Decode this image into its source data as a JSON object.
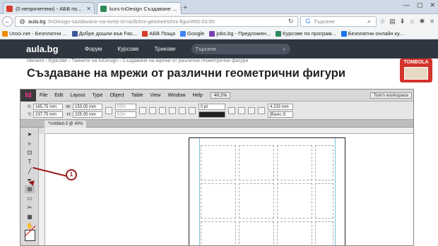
{
  "browser": {
    "tabs": [
      {
        "label": "(0 непрочетени) - АБВ по...",
        "favicon_color": "#d83b2c"
      },
      {
        "label": "kurs-InDesign Създаване ...",
        "favicon_color": "#2c8a5b"
      }
    ],
    "url_host": "aula.bg",
    "url_path": "/InDesign-sazdavane-na-mreji-ot-razlichni-geometrichni-figuri#00:03:50",
    "search_placeholder": "Търсене",
    "bookmarks": [
      {
        "label": "Uroci.net - Безплатни ...",
        "color": "#f08c00"
      },
      {
        "label": "Добре дошли във Fac...",
        "color": "#3b5998"
      },
      {
        "label": "АБВ Поща",
        "color": "#d83b2c"
      },
      {
        "label": "Google",
        "color": "#4285f4"
      },
      {
        "label": "jobs.bg - Предложен...",
        "color": "#7a3fb5"
      },
      {
        "label": "Курсове по програм...",
        "color": "#2c8a5b"
      },
      {
        "label": "Безплатни онлайн ку...",
        "color": "#1a73e8"
      }
    ]
  },
  "site": {
    "logo": "aula.bg",
    "nav": [
      "Форум",
      "Курсове",
      "Трикове"
    ],
    "search_placeholder": "Търсене",
    "breadcrumb": "Начало  ›  Курсове  ›  Тайните на InDesign  ›  Създаване на мрежи от различни геометрични фигури",
    "title": "Създаване на мрежи от различни геометрични фигури",
    "promo": "TOMBOLA"
  },
  "indesign": {
    "menu": [
      "File",
      "Edit",
      "Layout",
      "Type",
      "Object",
      "Table",
      "View",
      "Window",
      "Help"
    ],
    "zoom": "40,2%",
    "workspace": "Toni's workspace",
    "x": "165.75 mm",
    "y": "237.75 mm",
    "w": "153.05 mm",
    "h": "225.05 mm",
    "pct1": "63%",
    "pct2": "63%",
    "stroke": "0 pt",
    "size": "4.233 mm",
    "style": "[Basic G",
    "doc_tab": "*Untitled-3 @ 40%",
    "callout": "1"
  }
}
